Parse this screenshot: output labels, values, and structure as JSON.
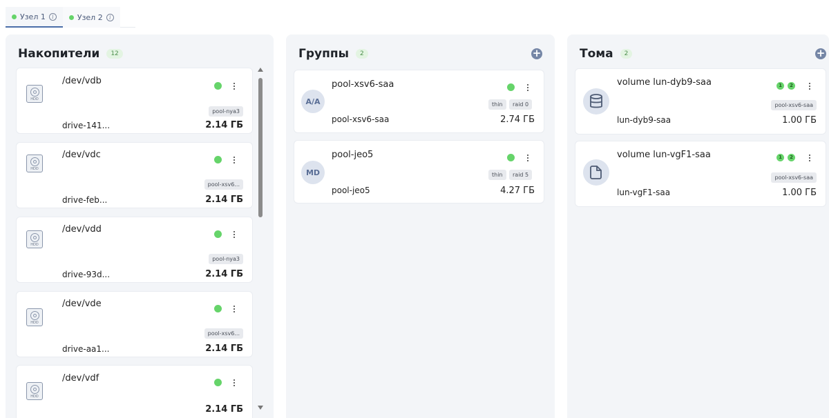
{
  "tabs": [
    {
      "label": "Узел 1",
      "active": true
    },
    {
      "label": "Узел 2",
      "active": false
    }
  ],
  "columns": {
    "drives": {
      "title": "Накопители",
      "count": "12",
      "items": [
        {
          "path": "/dev/vdb",
          "name": "drive-141...",
          "pool": "pool-nya3",
          "size": "2.14 ГБ"
        },
        {
          "path": "/dev/vdc",
          "name": "drive-feb...",
          "pool": "pool-xsv6...",
          "size": "2.14 ГБ"
        },
        {
          "path": "/dev/vdd",
          "name": "drive-93d...",
          "pool": "pool-nya3",
          "size": "2.14 ГБ"
        },
        {
          "path": "/dev/vde",
          "name": "drive-aa1...",
          "pool": "pool-xsv6...",
          "size": "2.14 ГБ"
        },
        {
          "path": "/dev/vdf",
          "name": "",
          "pool": "",
          "size": "2.14 ГБ"
        }
      ]
    },
    "groups": {
      "title": "Группы",
      "count": "2",
      "items": [
        {
          "avatar": "A/A",
          "title": "pool-xsv6-saa",
          "name": "pool-xsv6-saa",
          "tags": [
            "thin",
            "raid 0"
          ],
          "size": "2.74 ГБ"
        },
        {
          "avatar": "MD",
          "title": "pool-jeo5",
          "name": "pool-jeo5",
          "tags": [
            "thin",
            "raid 5"
          ],
          "size": "4.27 ГБ"
        }
      ]
    },
    "volumes": {
      "title": "Тома",
      "count": "2",
      "items": [
        {
          "icon": "database-icon",
          "title": "volume lun-dyb9-saa",
          "name": "lun-dyb9-saa",
          "pool": "pool-xsv6-saa",
          "size": "1.00 ГБ",
          "nodes": [
            "1",
            "2"
          ]
        },
        {
          "icon": "file-icon",
          "title": "volume lun-vgF1-saa",
          "name": "lun-vgF1-saa",
          "pool": "pool-xsv6-saa",
          "size": "1.00 ГБ",
          "nodes": [
            "1",
            "2"
          ]
        }
      ]
    }
  },
  "icons": {
    "hdd_label": "HDD",
    "add": "+"
  },
  "colors": {
    "status_ok": "#66d46a",
    "accent": "#4a6ea8",
    "panel_bg": "#f3f5f8"
  }
}
